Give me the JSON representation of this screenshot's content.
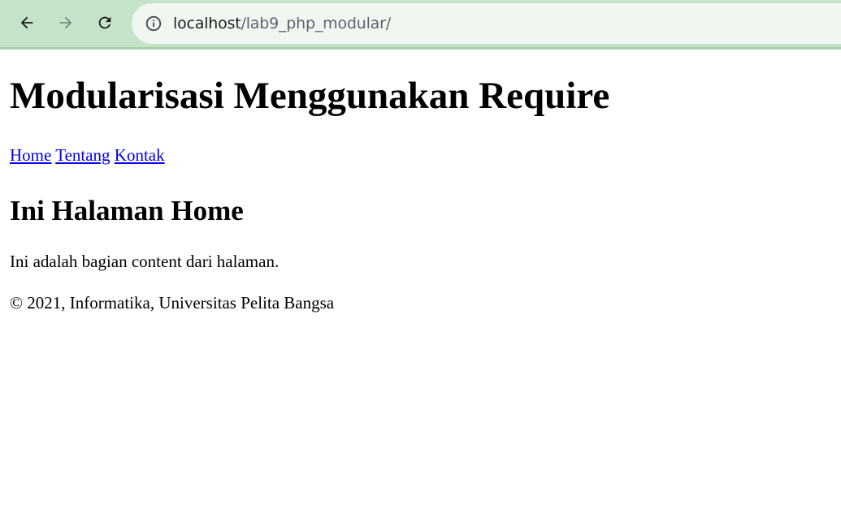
{
  "browser": {
    "url_host": "localhost",
    "url_path": "/lab9_php_modular/",
    "toolbar_color": "#c5e3c8",
    "omnibox_color": "#f0f7f1",
    "icons": {
      "back": "arrow-left-icon",
      "forward": "arrow-right-icon",
      "reload": "reload-icon",
      "site_info": "info-icon"
    }
  },
  "page": {
    "title": "Modularisasi Menggunakan Require",
    "nav": {
      "home": "Home",
      "tentang": "Tentang",
      "kontak": "Kontak"
    },
    "content": {
      "heading": "Ini Halaman Home",
      "text": "Ini adalah bagian content dari halaman."
    },
    "footer": "© 2021, Informatika, Universitas Pelita Bangsa",
    "link_color": "#0000ee"
  }
}
